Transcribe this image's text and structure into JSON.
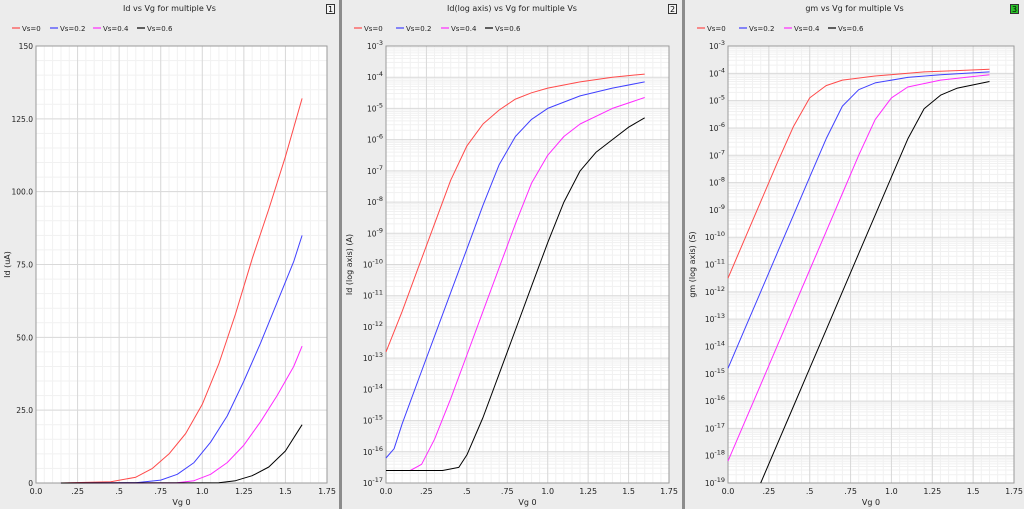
{
  "panels": [
    {
      "title": "Id vs Vg for multiple Vs",
      "index": "1",
      "active": false
    },
    {
      "title": "Id(log axis) vs Vg for multiple Vs",
      "index": "2",
      "active": false
    },
    {
      "title": "gm vs Vg for multiple Vs",
      "index": "3",
      "active": true
    }
  ],
  "chart_data": [
    {
      "type": "line",
      "title": "Id vs Vg for multiple Vs",
      "xlabel": "Vg 0",
      "ylabel": "Id (uA)",
      "xlim": [
        0,
        1.75
      ],
      "ylim": [
        0,
        150
      ],
      "yscale": "linear",
      "grid": true,
      "legend": "top-left",
      "xticks": [
        {
          "v": 0,
          "label": "0.0"
        },
        {
          "v": 0.25,
          "label": ".25"
        },
        {
          "v": 0.5,
          "label": ".5"
        },
        {
          "v": 0.75,
          "label": ".75"
        },
        {
          "v": 1.0,
          "label": "1.0"
        },
        {
          "v": 1.25,
          "label": "1.25"
        },
        {
          "v": 1.5,
          "label": "1.5"
        },
        {
          "v": 1.75,
          "label": "1.75"
        }
      ],
      "yticks": [
        {
          "v": 0,
          "label": "0"
        },
        {
          "v": 25,
          "label": "25.0"
        },
        {
          "v": 50,
          "label": "50.0"
        },
        {
          "v": 75,
          "label": "75.0"
        },
        {
          "v": 100,
          "label": "100.0"
        },
        {
          "v": 125,
          "label": "125.0"
        },
        {
          "v": 150,
          "label": "150"
        }
      ],
      "series": [
        {
          "name": "Vs=0",
          "color": "#ff4a4a",
          "points": [
            [
              0.15,
              0
            ],
            [
              0.45,
              0.4
            ],
            [
              0.6,
              2
            ],
            [
              0.7,
              5
            ],
            [
              0.8,
              10
            ],
            [
              0.9,
              17
            ],
            [
              1.0,
              27
            ],
            [
              1.1,
              41
            ],
            [
              1.2,
              58
            ],
            [
              1.3,
              77
            ],
            [
              1.4,
              94
            ],
            [
              1.5,
              112
            ],
            [
              1.6,
              132
            ]
          ]
        },
        {
          "name": "Vs=0.2",
          "color": "#4040ff",
          "points": [
            [
              0.15,
              0
            ],
            [
              0.6,
              0.1
            ],
            [
              0.75,
              1
            ],
            [
              0.85,
              3
            ],
            [
              0.95,
              7
            ],
            [
              1.05,
              14
            ],
            [
              1.15,
              23
            ],
            [
              1.25,
              35
            ],
            [
              1.35,
              48
            ],
            [
              1.45,
              62
            ],
            [
              1.55,
              76
            ],
            [
              1.6,
              85
            ]
          ]
        },
        {
          "name": "Vs=0.4",
          "color": "#ff2bff",
          "points": [
            [
              0.15,
              0
            ],
            [
              0.85,
              0.1
            ],
            [
              0.95,
              0.8
            ],
            [
              1.05,
              3
            ],
            [
              1.15,
              7
            ],
            [
              1.25,
              13
            ],
            [
              1.35,
              21
            ],
            [
              1.45,
              30
            ],
            [
              1.55,
              40
            ],
            [
              1.6,
              47
            ]
          ]
        },
        {
          "name": "Vs=0.6",
          "color": "#000000",
          "points": [
            [
              0.15,
              0
            ],
            [
              1.1,
              0.1
            ],
            [
              1.2,
              0.8
            ],
            [
              1.3,
              2.5
            ],
            [
              1.4,
              5.5
            ],
            [
              1.5,
              11
            ],
            [
              1.6,
              20
            ]
          ]
        }
      ]
    },
    {
      "type": "line",
      "title": "Id(log axis) vs Vg for multiple Vs",
      "xlabel": "Vg 0",
      "ylabel": "Id (log axis) (A)",
      "xlim": [
        0,
        1.75
      ],
      "ylim": [
        -17,
        -3
      ],
      "yscale": "log",
      "grid": true,
      "legend": "top-left",
      "xticks": [
        {
          "v": 0,
          "label": "0.0"
        },
        {
          "v": 0.25,
          "label": ".25"
        },
        {
          "v": 0.5,
          "label": ".5"
        },
        {
          "v": 0.75,
          "label": ".75"
        },
        {
          "v": 1.0,
          "label": "1.0"
        },
        {
          "v": 1.25,
          "label": "1.25"
        },
        {
          "v": 1.5,
          "label": "1.5"
        },
        {
          "v": 1.75,
          "label": "1.75"
        }
      ],
      "yticks": [
        {
          "v": -3,
          "label": "10-3"
        },
        {
          "v": -4,
          "label": "10-4"
        },
        {
          "v": -5,
          "label": "10-5"
        },
        {
          "v": -6,
          "label": "10-6"
        },
        {
          "v": -7,
          "label": "10-7"
        },
        {
          "v": -8,
          "label": "10-8"
        },
        {
          "v": -9,
          "label": "10-9"
        },
        {
          "v": -10,
          "label": "10-10"
        },
        {
          "v": -11,
          "label": "10-11"
        },
        {
          "v": -12,
          "label": "10-12"
        },
        {
          "v": -13,
          "label": "10-13"
        },
        {
          "v": -14,
          "label": "10-14"
        },
        {
          "v": -15,
          "label": "10-15"
        },
        {
          "v": -16,
          "label": "10-16"
        },
        {
          "v": -17,
          "label": "10-17"
        }
      ],
      "series": [
        {
          "name": "Vs=0",
          "color": "#ff4a4a",
          "points": [
            [
              0,
              -12.8
            ],
            [
              0.1,
              -11.5
            ],
            [
              0.2,
              -10.1
            ],
            [
              0.3,
              -8.7
            ],
            [
              0.4,
              -7.3
            ],
            [
              0.5,
              -6.2
            ],
            [
              0.6,
              -5.5
            ],
            [
              0.7,
              -5.05
            ],
            [
              0.8,
              -4.7
            ],
            [
              0.9,
              -4.5
            ],
            [
              1.0,
              -4.35
            ],
            [
              1.2,
              -4.15
            ],
            [
              1.4,
              -4.0
            ],
            [
              1.6,
              -3.9
            ]
          ]
        },
        {
          "name": "Vs=0.2",
          "color": "#4040ff",
          "points": [
            [
              0,
              -16.2
            ],
            [
              0.05,
              -15.9
            ],
            [
              0.1,
              -15.1
            ],
            [
              0.2,
              -13.7
            ],
            [
              0.3,
              -12.3
            ],
            [
              0.4,
              -10.9
            ],
            [
              0.5,
              -9.5
            ],
            [
              0.6,
              -8.1
            ],
            [
              0.7,
              -6.8
            ],
            [
              0.8,
              -5.9
            ],
            [
              0.9,
              -5.35
            ],
            [
              1.0,
              -5.0
            ],
            [
              1.2,
              -4.6
            ],
            [
              1.4,
              -4.35
            ],
            [
              1.6,
              -4.15
            ]
          ]
        },
        {
          "name": "Vs=0.4",
          "color": "#ff2bff",
          "points": [
            [
              0,
              -16.6
            ],
            [
              0.15,
              -16.6
            ],
            [
              0.22,
              -16.4
            ],
            [
              0.3,
              -15.6
            ],
            [
              0.4,
              -14.3
            ],
            [
              0.5,
              -12.9
            ],
            [
              0.6,
              -11.5
            ],
            [
              0.7,
              -10.1
            ],
            [
              0.8,
              -8.7
            ],
            [
              0.9,
              -7.4
            ],
            [
              1.0,
              -6.5
            ],
            [
              1.1,
              -5.9
            ],
            [
              1.2,
              -5.5
            ],
            [
              1.4,
              -5.0
            ],
            [
              1.6,
              -4.65
            ]
          ]
        },
        {
          "name": "Vs=0.6",
          "color": "#000000",
          "points": [
            [
              0,
              -16.6
            ],
            [
              0.35,
              -16.6
            ],
            [
              0.45,
              -16.5
            ],
            [
              0.5,
              -16.1
            ],
            [
              0.6,
              -14.9
            ],
            [
              0.7,
              -13.5
            ],
            [
              0.8,
              -12.1
            ],
            [
              0.9,
              -10.7
            ],
            [
              1.0,
              -9.3
            ],
            [
              1.1,
              -8.0
            ],
            [
              1.2,
              -7.0
            ],
            [
              1.3,
              -6.4
            ],
            [
              1.4,
              -6.0
            ],
            [
              1.5,
              -5.6
            ],
            [
              1.6,
              -5.3
            ]
          ]
        }
      ]
    },
    {
      "type": "line",
      "title": "gm vs Vg for multiple Vs",
      "xlabel": "Vg 0",
      "ylabel": "gm (log axis) (S)",
      "xlim": [
        0,
        1.75
      ],
      "ylim": [
        -19,
        -3
      ],
      "yscale": "log",
      "grid": true,
      "legend": "top-left",
      "xticks": [
        {
          "v": 0,
          "label": "0.0"
        },
        {
          "v": 0.25,
          "label": ".25"
        },
        {
          "v": 0.5,
          "label": ".5"
        },
        {
          "v": 0.75,
          "label": ".75"
        },
        {
          "v": 1.0,
          "label": "1.0"
        },
        {
          "v": 1.25,
          "label": "1.25"
        },
        {
          "v": 1.5,
          "label": "1.5"
        },
        {
          "v": 1.75,
          "label": "1.75"
        }
      ],
      "yticks": [
        {
          "v": -3,
          "label": "10-3"
        },
        {
          "v": -4,
          "label": "10-4"
        },
        {
          "v": -5,
          "label": "10-5"
        },
        {
          "v": -6,
          "label": "10-6"
        },
        {
          "v": -7,
          "label": "10-7"
        },
        {
          "v": -8,
          "label": "10-8"
        },
        {
          "v": -9,
          "label": "10-9"
        },
        {
          "v": -10,
          "label": "10-10"
        },
        {
          "v": -11,
          "label": "10-11"
        },
        {
          "v": -12,
          "label": "10-12"
        },
        {
          "v": -13,
          "label": "10-13"
        },
        {
          "v": -14,
          "label": "10-14"
        },
        {
          "v": -15,
          "label": "10-15"
        },
        {
          "v": -16,
          "label": "10-16"
        },
        {
          "v": -17,
          "label": "10-17"
        },
        {
          "v": -18,
          "label": "10-18"
        },
        {
          "v": -19,
          "label": "10-19"
        }
      ],
      "series": [
        {
          "name": "Vs=0",
          "color": "#ff4a4a",
          "points": [
            [
              0,
              -11.5
            ],
            [
              0.1,
              -10.1
            ],
            [
              0.2,
              -8.7
            ],
            [
              0.3,
              -7.3
            ],
            [
              0.4,
              -5.95
            ],
            [
              0.5,
              -4.9
            ],
            [
              0.6,
              -4.45
            ],
            [
              0.7,
              -4.25
            ],
            [
              0.9,
              -4.1
            ],
            [
              1.2,
              -3.95
            ],
            [
              1.4,
              -3.9
            ],
            [
              1.6,
              -3.85
            ]
          ]
        },
        {
          "name": "Vs=0.2",
          "color": "#4040ff",
          "points": [
            [
              0,
              -14.8
            ],
            [
              0.1,
              -13.4
            ],
            [
              0.2,
              -12.0
            ],
            [
              0.3,
              -10.6
            ],
            [
              0.4,
              -9.2
            ],
            [
              0.5,
              -7.8
            ],
            [
              0.6,
              -6.4
            ],
            [
              0.7,
              -5.2
            ],
            [
              0.8,
              -4.6
            ],
            [
              0.9,
              -4.35
            ],
            [
              1.1,
              -4.15
            ],
            [
              1.3,
              -4.05
            ],
            [
              1.6,
              -3.95
            ]
          ]
        },
        {
          "name": "Vs=0.4",
          "color": "#ff2bff",
          "points": [
            [
              0,
              -18.2
            ],
            [
              0.1,
              -16.8
            ],
            [
              0.2,
              -15.4
            ],
            [
              0.3,
              -14.0
            ],
            [
              0.4,
              -12.6
            ],
            [
              0.5,
              -11.2
            ],
            [
              0.6,
              -9.8
            ],
            [
              0.7,
              -8.4
            ],
            [
              0.8,
              -7.0
            ],
            [
              0.9,
              -5.7
            ],
            [
              1.0,
              -4.9
            ],
            [
              1.1,
              -4.5
            ],
            [
              1.3,
              -4.25
            ],
            [
              1.6,
              -4.05
            ]
          ]
        },
        {
          "name": "Vs=0.6",
          "color": "#000000",
          "points": [
            [
              0.2,
              -19.0
            ],
            [
              0.3,
              -17.6
            ],
            [
              0.4,
              -16.2
            ],
            [
              0.5,
              -14.8
            ],
            [
              0.6,
              -13.4
            ],
            [
              0.7,
              -12.0
            ],
            [
              0.8,
              -10.6
            ],
            [
              0.9,
              -9.2
            ],
            [
              1.0,
              -7.8
            ],
            [
              1.1,
              -6.4
            ],
            [
              1.2,
              -5.3
            ],
            [
              1.3,
              -4.8
            ],
            [
              1.4,
              -4.55
            ],
            [
              1.6,
              -4.3
            ]
          ]
        }
      ]
    }
  ]
}
